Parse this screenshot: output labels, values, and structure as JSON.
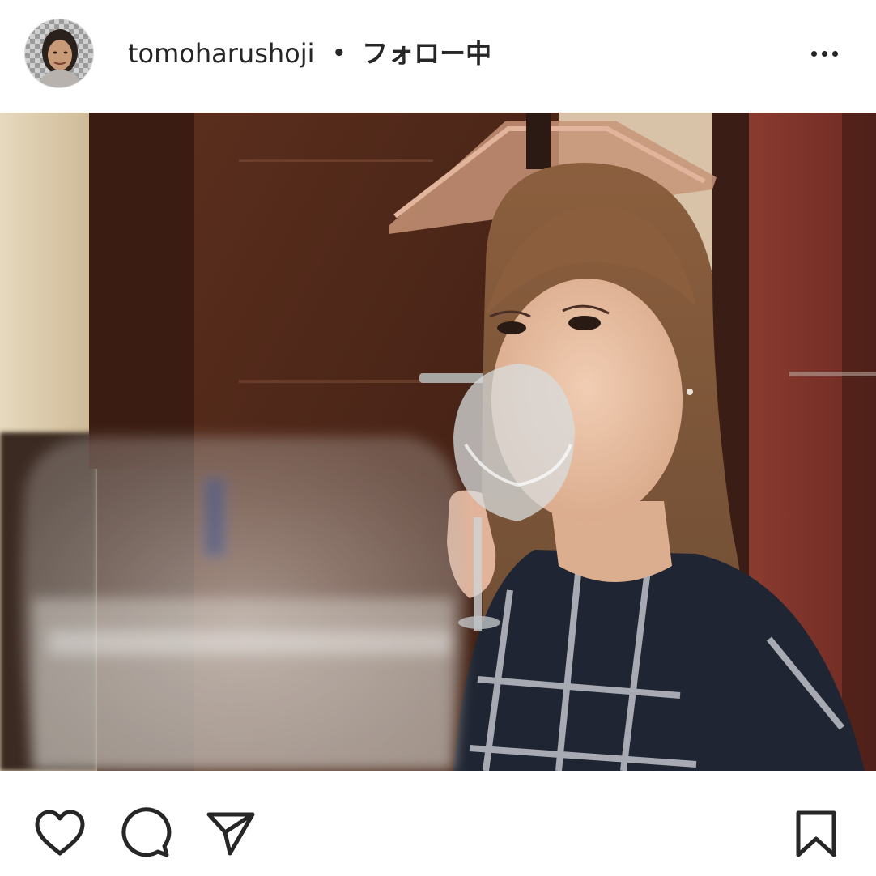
{
  "post_header": {
    "username": "tomoharushoji",
    "separator": "•",
    "follow_status": "フォロー中",
    "more_options_icon": "more-horizontal-icon"
  },
  "photo": {
    "subject": "woman sipping from a wine glass of water in a restaurant"
  },
  "actions": {
    "like_icon": "heart-icon",
    "comment_icon": "comment-bubble-icon",
    "share_icon": "paper-plane-icon",
    "save_icon": "bookmark-icon"
  },
  "colors": {
    "text": "#262626",
    "background": "#ffffff"
  }
}
